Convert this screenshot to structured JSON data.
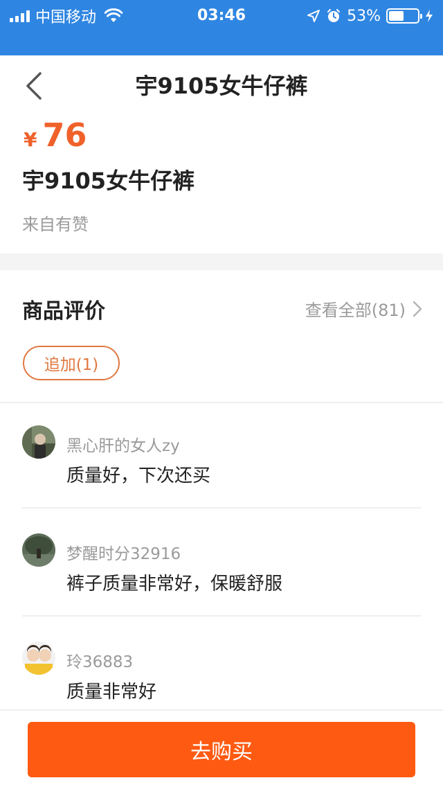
{
  "status_bar": {
    "carrier": "中国移动",
    "time": "03:46",
    "battery_percent": "53%",
    "battery_level": 0.53
  },
  "nav": {
    "title": "宇9105女牛仔裤",
    "back_icon": "chevron-left-icon"
  },
  "product": {
    "currency": "¥",
    "price": "76",
    "title": "宇9105女牛仔裤",
    "source": "来自有赞"
  },
  "reviews": {
    "heading": "商品评价",
    "view_all": "查看全部(81)",
    "tag": "追加(1)",
    "items": [
      {
        "user": "黑心肝的女人zy",
        "text": "质量好，下次还买"
      },
      {
        "user": "梦醒时分32916",
        "text": "裤子质量非常好，保暖舒服"
      },
      {
        "user": "玲36883",
        "text": "质量非常好"
      }
    ]
  },
  "footer": {
    "buy_label": "去购买"
  },
  "colors": {
    "status_bar": "#2f86e2",
    "accent": "#f0612a",
    "buy_button": "#ff5a12"
  }
}
